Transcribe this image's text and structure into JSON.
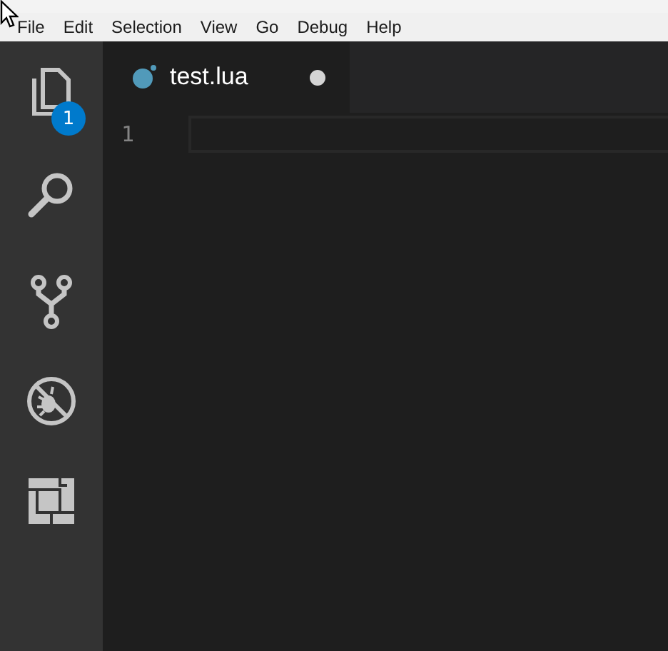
{
  "menu_bar": {
    "items": [
      "File",
      "Edit",
      "Selection",
      "View",
      "Go",
      "Debug",
      "Help"
    ]
  },
  "activity_bar": {
    "items": [
      {
        "kind": "files",
        "badge": "1"
      },
      {
        "kind": "search"
      },
      {
        "kind": "git"
      },
      {
        "kind": "debug"
      },
      {
        "kind": "extensions"
      }
    ]
  },
  "tabs": [
    {
      "label": "test.lua",
      "selected": true,
      "dirty": true
    }
  ],
  "editor": {
    "line_numbers": [
      "1"
    ]
  }
}
